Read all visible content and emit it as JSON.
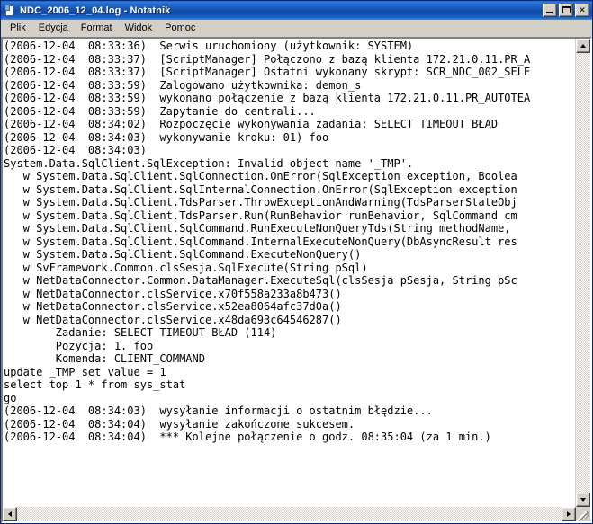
{
  "window": {
    "title": "NDC_2006_12_04.log - Notatnik",
    "icon": "notepad-document-icon",
    "title_bar_color": "#0f4aa8",
    "frame_color": "#d4d0c8",
    "caption_buttons": [
      {
        "name": "minimize",
        "label": "_"
      },
      {
        "name": "maximize",
        "label": "□"
      },
      {
        "name": "close",
        "label": "✕"
      }
    ]
  },
  "menu": {
    "items": [
      {
        "label": "Plik"
      },
      {
        "label": "Edycja"
      },
      {
        "label": "Format"
      },
      {
        "label": "Widok"
      },
      {
        "label": "Pomoc"
      }
    ]
  },
  "editor": {
    "background": "#ffffff",
    "text_color": "#000000",
    "caret_visible": true,
    "lines": [
      "(2006-12-04  08:33:36)  Serwis uruchomiony (użytkownik: SYSTEM)",
      "(2006-12-04  08:33:37)  [ScriptManager] Połączono z bazą klienta 172.21.0.11.PR_A",
      "(2006-12-04  08:33:37)  [ScriptManager] Ostatni wykonany skrypt: SCR_NDC_002_SELE",
      "(2006-12-04  08:33:59)  Zalogowano użytkownika: demon_s",
      "(2006-12-04  08:33:59)  wykonano połączenie z bazą klienta 172.21.0.11.PR_AUTOTEA",
      "(2006-12-04  08:33:59)  Zapytanie do centrali...",
      "(2006-12-04  08:34:02)  Rozpoczęcie wykonywania zadania: SELECT TIMEOUT BŁAD",
      "(2006-12-04  08:34:03)  wykonywanie kroku: 01) foo",
      "(2006-12-04  08:34:03)",
      "System.Data.SqlClient.SqlException: Invalid object name '_TMP'.",
      "   w System.Data.SqlClient.SqlConnection.OnError(SqlException exception, Boolea",
      "   w System.Data.SqlClient.SqlInternalConnection.OnError(SqlException exception",
      "   w System.Data.SqlClient.TdsParser.ThrowExceptionAndWarning(TdsParserStateObj",
      "   w System.Data.SqlClient.TdsParser.Run(RunBehavior runBehavior, SqlCommand cm",
      "   w System.Data.SqlClient.SqlCommand.RunExecuteNonQueryTds(String methodName,",
      "   w System.Data.SqlClient.SqlCommand.InternalExecuteNonQuery(DbAsyncResult res",
      "   w System.Data.SqlClient.SqlCommand.ExecuteNonQuery()",
      "   w SvFramework.Common.clsSesja.SqlExecute(String pSql)",
      "   w NetDataConnector.Common.DataManager.ExecuteSql(clsSesja pSesja, String pSc",
      "   w NetDataConnector.clsService.x70f558a233a8b473()",
      "   w NetDataConnector.clsService.x52ea8064afc37d0a()",
      "   w NetDataConnector.clsService.x48da693c64546287()",
      "        Zadanie: SELECT TIMEOUT BŁAD (114)",
      "        Pozycja: 1. foo",
      "        Komenda: CLIENT_COMMAND",
      "update _TMP set value = 1",
      "select top 1 * from sys_stat",
      "go",
      "(2006-12-04  08:34:03)  wysyłanie informacji o ostatnim błędzie...",
      "(2006-12-04  08:34:04)  wysyłanie zakończone sukcesem.",
      "(2006-12-04  08:34:04)  *** Kolejne połączenie o godz. 08:35:04 (za 1 min.)"
    ]
  },
  "scrollbars": {
    "vertical": {
      "up_arrow": "scroll-up-arrow",
      "down_arrow": "scroll-down-arrow",
      "thumb_visible": false
    },
    "horizontal": {
      "left_arrow": "scroll-left-arrow",
      "right_arrow": "scroll-right-arrow",
      "thumb_visible": false
    },
    "resize_grip": "resize-grip"
  }
}
